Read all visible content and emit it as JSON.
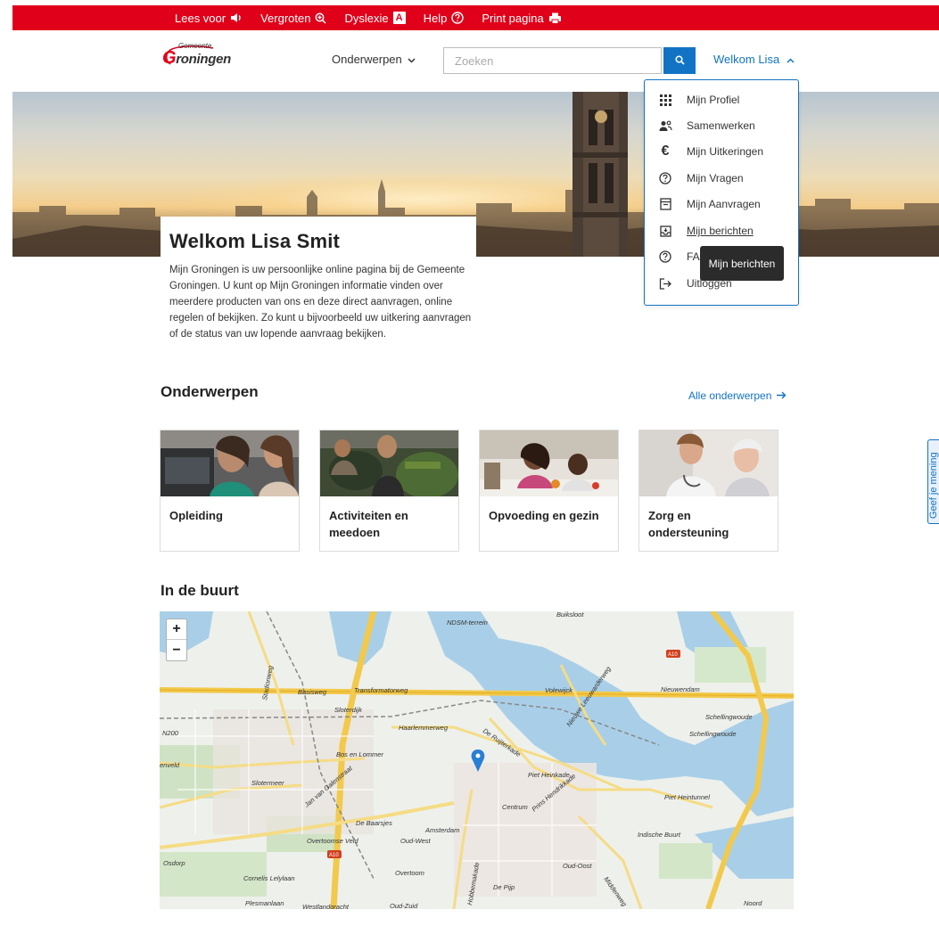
{
  "topbar": {
    "items": [
      {
        "label": "Lees voor",
        "icon": "speaker-icon"
      },
      {
        "label": "Vergroten",
        "icon": "zoom-in-icon"
      },
      {
        "label": "Dyslexie",
        "icon": "dyslexia-icon"
      },
      {
        "label": "Help",
        "icon": "help-icon"
      },
      {
        "label": "Print pagina",
        "icon": "printer-icon"
      }
    ],
    "dyslexia_glyph": "A"
  },
  "header": {
    "logo_small": "Gemeente",
    "logo_main_initial": "G",
    "logo_main_rest": "roningen",
    "nav_topics": "Onderwerpen",
    "search_placeholder": "Zoeken",
    "user_label": "Welkom Lisa"
  },
  "user_menu": {
    "items": [
      {
        "label": "Mijn Profiel",
        "icon": "grid-icon"
      },
      {
        "label": "Samenwerken",
        "icon": "people-icon"
      },
      {
        "label": "Mijn Uitkeringen",
        "icon": "euro-icon"
      },
      {
        "label": "Mijn Vragen",
        "icon": "question-icon"
      },
      {
        "label": "Mijn Aanvragen",
        "icon": "archive-icon"
      },
      {
        "label": "Mijn berichten",
        "icon": "inbox-icon"
      },
      {
        "label": "FAQ",
        "icon": "question-icon"
      },
      {
        "label": "Uitloggen",
        "icon": "logout-icon"
      }
    ],
    "euro_glyph": "€",
    "tooltip": "Mijn berichten"
  },
  "welcome": {
    "title": "Welkom Lisa Smit",
    "text": "Mijn Groningen is uw persoonlijke online pagina bij de Gemeente Groningen. U kunt op Mijn Groningen informatie vinden over meerdere producten van ons en deze direct aanvragen, online regelen of bekijken. Zo kunt u bijvoorbeeld uw uitkering aanvragen of de status van uw lopende aanvraag bekijken."
  },
  "topics": {
    "title": "Onderwerpen",
    "all_link": "Alle onderwerpen",
    "cards": [
      {
        "label": "Opleiding"
      },
      {
        "label": "Activiteiten en meedoen"
      },
      {
        "label": "Opvoeding en gezin"
      },
      {
        "label": "Zorg en ondersteuning"
      }
    ]
  },
  "nearby": {
    "title": "In de buurt",
    "zoom_in": "+",
    "zoom_out": "−",
    "map_labels": [
      "Buiksloot",
      "NDSM-terrein",
      "Basisweg",
      "Transformatorweg",
      "Sloterdijk",
      "Haarlemmerweg",
      "Volewijck",
      "Nieuwe Leeuwarderweg",
      "Nieuwendam",
      "Schellingwoude",
      "N200",
      "Bos en Lommer",
      "De Ruijterkade",
      "Piet Heinkade",
      "Slotermeer",
      "Jan van Galenstraat",
      "Centrum",
      "Prins Hendrikkade",
      "Piet Heintunnel",
      "Amsterdam",
      "De Baarsjes",
      "Overtoomse Veld",
      "Oud-West",
      "Osdorp",
      "Cornelis Lelylaan",
      "Overtoom",
      "Indische Buurt",
      "Oud-Oost",
      "Plesmanlaan",
      "Oud-Zuid",
      "De Pijp",
      "Noord",
      "Westlandgracht",
      "Hobbemakade",
      "Middenweg",
      "A10",
      "enveld"
    ]
  },
  "side_tab": {
    "label": "Geef je mening"
  },
  "colors": {
    "brand_red": "#e0001a",
    "link_blue": "#1273c4"
  }
}
